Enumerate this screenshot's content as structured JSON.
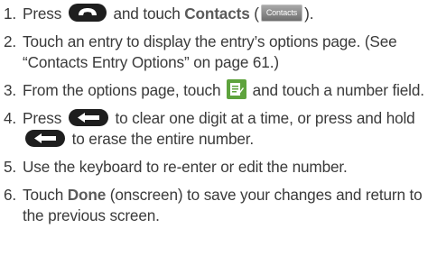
{
  "steps": [
    {
      "num": "1.",
      "t1": "Press",
      "icon1": "phone-key-icon",
      "t2": "and touch",
      "bold": "Contacts",
      "t3": "(",
      "tab_label": "Contacts",
      "t4": ")."
    },
    {
      "num": "2.",
      "text": "Touch an entry to display the entry’s options page. (See “Contacts Entry Options” on page 61.)"
    },
    {
      "num": "3.",
      "t1": "From the options page, touch",
      "icon1": "edit-icon",
      "t2": "and touch a number field."
    },
    {
      "num": "4.",
      "t1": "Press",
      "icon1": "back-key-icon",
      "t2": "to clear one digit at a time, or press and hold",
      "icon2": "back-key-icon",
      "t3": "to erase the entire number."
    },
    {
      "num": "5.",
      "text": "Use the keyboard to re-enter or edit the number."
    },
    {
      "num": "6.",
      "t1": "Touch",
      "bold": "Done",
      "t2": "(onscreen) to save your changes and return to the previous screen."
    }
  ],
  "colors": {
    "text": "#3a3a3a",
    "edit_icon_bg": "#5ea33d",
    "key_bg": "#1e1e1e"
  }
}
